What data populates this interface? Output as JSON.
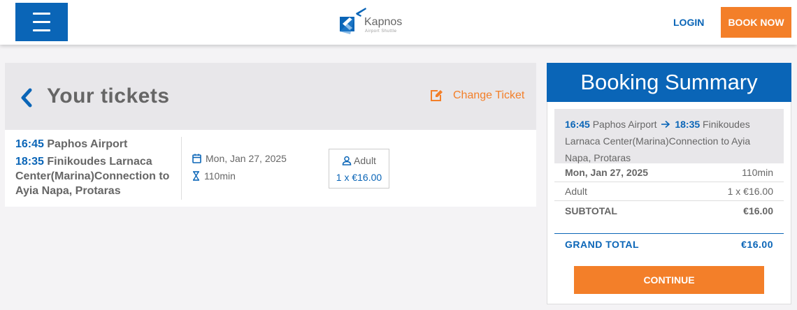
{
  "header": {
    "brand_name": "Kapnos",
    "brand_tagline": "Airport Shuttle",
    "login_label": "LOGIN",
    "book_now_label": "BOOK NOW"
  },
  "tickets": {
    "title": "Your tickets",
    "change_label": "Change Ticket",
    "departure_time": "16:45",
    "departure_stop": "Paphos Airport",
    "arrival_time": "18:35",
    "arrival_stop": "Finikoudes Larnaca Center(Marina)Connection to Ayia Napa, Protaras",
    "date": "Mon, Jan 27, 2025",
    "duration": "110min",
    "passenger_type": "Adult",
    "passenger_price": "1 x €16.00"
  },
  "summary": {
    "title": "Booking Summary",
    "departure_time": "16:45",
    "departure_stop": "Paphos Airport",
    "arrival_time": "18:35",
    "arrival_stop": "Finikoudes Larnaca Center(Marina)Connection to Ayia Napa, Protaras",
    "date": "Mon, Jan 27, 2025",
    "duration": "110min",
    "passenger_type": "Adult",
    "passenger_price": "1 x €16.00",
    "subtotal_label": "SUBTOTAL",
    "subtotal_value": "€16.00",
    "grand_total_label": "GRAND TOTAL",
    "grand_total_value": "€16.00",
    "continue_label": "CONTINUE"
  },
  "colors": {
    "brand_blue": "#0a65b7",
    "accent_orange": "#f37f29"
  },
  "icons": [
    "menu-icon",
    "logo-icon",
    "chevron-left-icon",
    "edit-icon",
    "calendar-icon",
    "hourglass-icon",
    "user-icon",
    "arrow-right-icon"
  ]
}
